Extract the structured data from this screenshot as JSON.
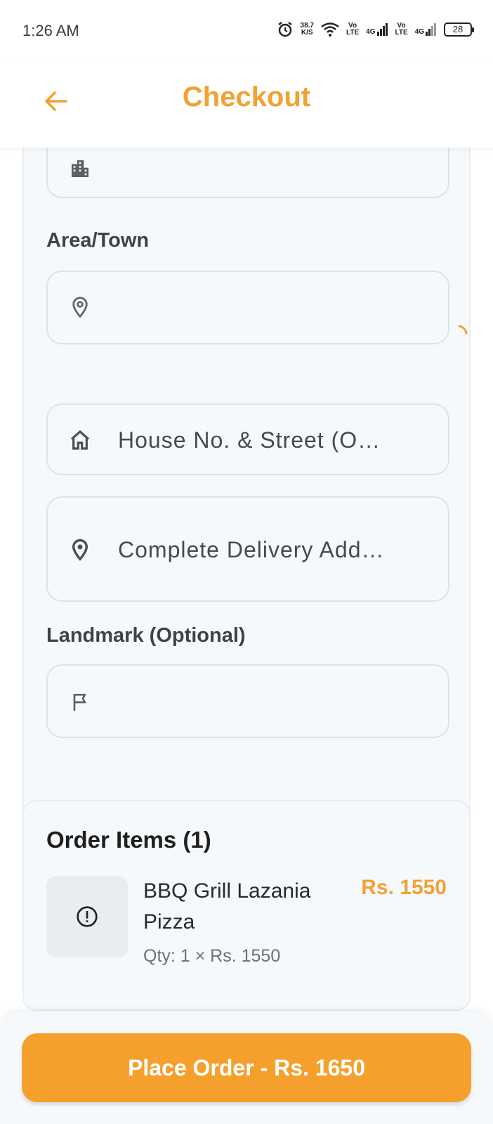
{
  "status_bar": {
    "time": "1:26 AM",
    "speed_value": "38.7",
    "speed_unit": "K/S",
    "sim1_label_top": "Vo",
    "sim1_label_bottom": "LTE",
    "sim1_net": "4G",
    "sim2_label_top": "Vo",
    "sim2_label_bottom": "LTE",
    "sim2_net": "4G",
    "battery": "28",
    "icons": [
      "alarm-icon",
      "wifi-icon",
      "signal-icon",
      "battery-icon"
    ]
  },
  "header": {
    "title": "Checkout",
    "back_icon": "arrow-left-icon"
  },
  "address_form": {
    "area_label": "Area/Town",
    "house_placeholder": "House No. & Street (O…",
    "delivery_placeholder": "Complete Delivery Add…",
    "landmark_label": "Landmark (Optional)"
  },
  "order_items": {
    "title": "Order Items (1)",
    "items": [
      {
        "name": "BBQ Grill Lazania Pizza",
        "price": "Rs. 1550",
        "qty_text": "Qty: 1 × Rs. 1550"
      }
    ]
  },
  "footer": {
    "place_order_label": "Place Order - Rs. 1650"
  },
  "colors": {
    "accent": "#F2A134",
    "button": "#F5A02C",
    "card_bg": "#F6F9FC",
    "border": "#DCE3EA"
  }
}
